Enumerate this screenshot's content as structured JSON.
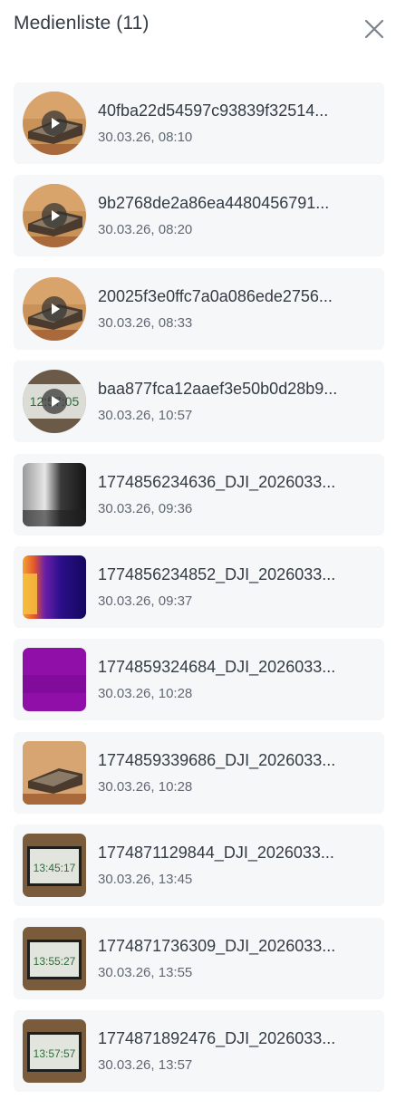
{
  "header": {
    "title": "Medienliste (11)",
    "close_icon": "close-icon"
  },
  "items": [
    {
      "name": "40fba22d54597c93839f32514...",
      "date": "30.03.26, 08:10",
      "type": "video"
    },
    {
      "name": "9b2768de2a86ea4480456791...",
      "date": "30.03.26, 08:20",
      "type": "video"
    },
    {
      "name": "20025f3e0ffc7a0a086ede2756...",
      "date": "30.03.26, 08:33",
      "type": "video"
    },
    {
      "name": "baa877fca12aaef3e50b0d28b9...",
      "date": "30.03.26, 10:57",
      "type": "video",
      "thumb_text": "12:57:05"
    },
    {
      "name": "1774856234636_DJI_2026033...",
      "date": "30.03.26, 09:36",
      "type": "image"
    },
    {
      "name": "1774856234852_DJI_2026033...",
      "date": "30.03.26, 09:37",
      "type": "image"
    },
    {
      "name": "1774859324684_DJI_2026033...",
      "date": "30.03.26, 10:28",
      "type": "image"
    },
    {
      "name": "1774859339686_DJI_2026033...",
      "date": "30.03.26, 10:28",
      "type": "image"
    },
    {
      "name": "1774871129844_DJI_2026033...",
      "date": "30.03.26, 13:45",
      "type": "image",
      "thumb_text": "13:45:17"
    },
    {
      "name": "1774871736309_DJI_2026033...",
      "date": "30.03.26, 13:55",
      "type": "image",
      "thumb_text": "13:55:27"
    },
    {
      "name": "1774871892476_DJI_2026033...",
      "date": "30.03.26, 13:57",
      "type": "image",
      "thumb_text": "13:57:57"
    }
  ]
}
